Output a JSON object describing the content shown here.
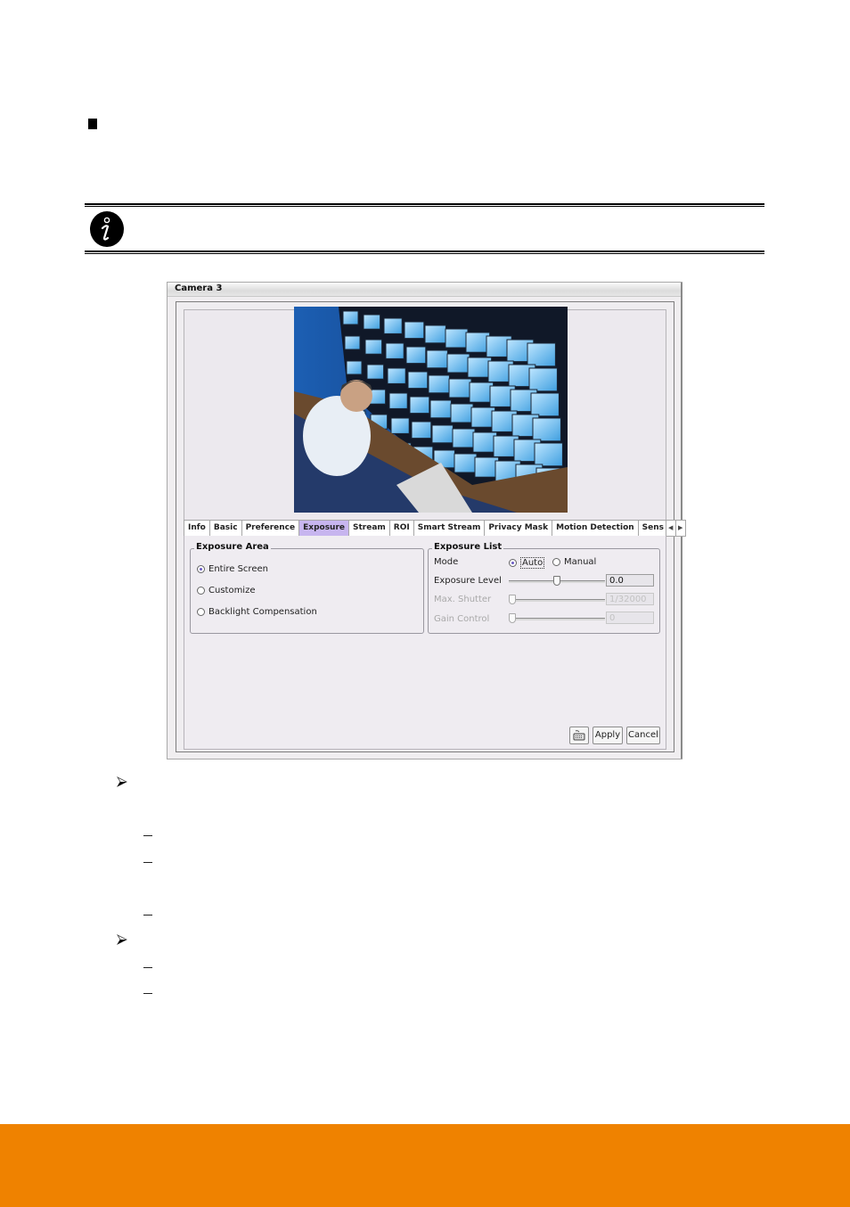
{
  "document": {
    "footer_color": "#EF8200",
    "note_icon": "info-icon",
    "section_bullet": "square-bullet-icon",
    "lower_bullets": [
      {
        "type": "arrow",
        "sub_items": 3
      },
      {
        "type": "arrow",
        "sub_items": 2
      }
    ]
  },
  "window": {
    "title": "Camera 3",
    "preview_image": "surveillance-control-room-photo",
    "tabs": [
      {
        "label": "Info",
        "active": false
      },
      {
        "label": "Basic",
        "active": false
      },
      {
        "label": "Preference",
        "active": false
      },
      {
        "label": "Exposure",
        "active": true
      },
      {
        "label": "Stream",
        "active": false
      },
      {
        "label": "ROI",
        "active": false
      },
      {
        "label": "Smart Stream",
        "active": false
      },
      {
        "label": "Privacy Mask",
        "active": false
      },
      {
        "label": "Motion Detection",
        "active": false
      },
      {
        "label": "Sens",
        "active": false
      }
    ],
    "tab_scroll_left": "◀",
    "tab_scroll_right": "▶",
    "active_tab_color": "#C7B5EF",
    "exposure_area": {
      "title": "Exposure Area",
      "options": [
        {
          "label": "Entire Screen",
          "checked": true
        },
        {
          "label": "Customize",
          "checked": false
        },
        {
          "label": "Backlight Compensation",
          "checked": false
        }
      ]
    },
    "exposure_list": {
      "title": "Exposure List",
      "mode_label": "Mode",
      "mode_options": [
        {
          "label": "Auto",
          "checked": true
        },
        {
          "label": "Manual",
          "checked": false
        }
      ],
      "exposure_level": {
        "label": "Exposure Level",
        "value": "0.0",
        "slider_fraction": 0.5,
        "enabled": true
      },
      "max_shutter": {
        "label": "Max. Shutter",
        "value": "1/32000",
        "slider_fraction": 0.0,
        "enabled": false
      },
      "gain_control": {
        "label": "Gain Control",
        "value": "0",
        "slider_fraction": 0.0,
        "enabled": false
      }
    },
    "buttons": {
      "keyboard_icon": "keyboard-icon",
      "apply": "Apply",
      "cancel": "Cancel"
    }
  }
}
